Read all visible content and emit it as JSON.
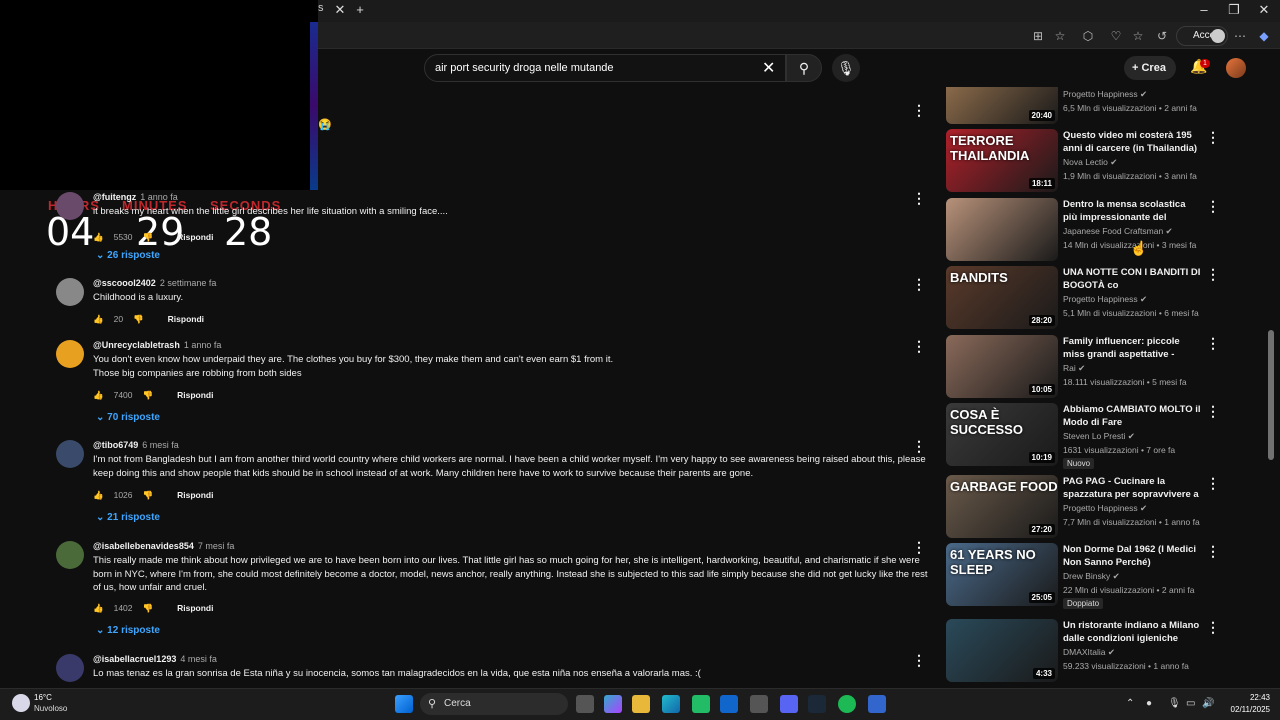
{
  "browser": {
    "tab_title": "s",
    "login_label": "Accedi"
  },
  "timer": {
    "hours_label": "HOURS",
    "minutes_label": "MINUTES",
    "seconds_label": "SECONDS",
    "hours": "04",
    "minutes": "29",
    "seconds": "28"
  },
  "youtube": {
    "search_value": "air port security droga nelle mutande",
    "create_label": "Crea",
    "notifications_count": "1"
  },
  "comments": [
    {
      "handle": "@fuitengz",
      "when": "1 anno fa",
      "text": "it breaks my heart when the little girl describes her life situation with a smiling face....",
      "likes": "5530",
      "reply_label": "Rispondi",
      "replies": "26 risposte"
    },
    {
      "handle": "@sscoool2402",
      "when": "2 settimane fa",
      "text": "Childhood is a luxury.",
      "likes": "20",
      "reply_label": "Rispondi",
      "replies": ""
    },
    {
      "handle": "@Unrecyclabletrash",
      "when": "1 anno fa",
      "text": "You don't even know how underpaid they are. The clothes you buy for $300, they make them and can't even earn $1 from it.\nThose big companies are robbing from both sides",
      "likes": "7400",
      "reply_label": "Rispondi",
      "replies": "70 risposte"
    },
    {
      "handle": "@tibo6749",
      "when": "6 mesi fa",
      "text": "I'm not from Bangladesh but I am from another third world country where child workers are normal. I have been a child worker myself. I'm very happy to see awareness being raised about this, please keep doing this and show people that kids should be in school instead of at work. Many children here have to work to survive because their parents are gone.",
      "likes": "1026",
      "reply_label": "Rispondi",
      "replies": "21 risposte"
    },
    {
      "handle": "@isabellebenavides854",
      "when": "7 mesi fa",
      "text": "This really made me think about how privileged we are to have been born into our lives. That little girl has so much going for her, she is intelligent, hardworking, beautiful, and charismatic if she were born in NYC, where I'm from, she could most definitely become a doctor, model, news anchor, really anything. Instead she is subjected to this sad life simply because she did not get lucky like the rest of us, how unfair and cruel.",
      "likes": "1402",
      "reply_label": "Rispondi",
      "replies": "12 risposte"
    },
    {
      "handle": "@isabellacruel1293",
      "when": "4 mesi fa",
      "text": "Lo mas tenaz es la gran sonrisa de Esta niña y su inocencia, somos tan malagradecidos en la vida, que esta niña nos enseña a valorarla mas. :(",
      "likes": "",
      "reply_label": "",
      "replies": ""
    }
  ],
  "videos": [
    {
      "title": "",
      "channel": "Progetto Happiness",
      "stats": "6,5 Mln di visualizzazioni • 2 anni fa",
      "duration": "20:40",
      "thumb_text": "",
      "badge": "",
      "color": "#8a6a4a"
    },
    {
      "title": "Questo video mi costerà 195 anni di carcere (in Thailandia)",
      "channel": "Nova Lectio",
      "stats": "1,9 Mln di visualizzazioni • 3 anni fa",
      "duration": "18:11",
      "thumb_text": "TERRORE THAILANDIA",
      "badge": "",
      "color": "#b0202a"
    },
    {
      "title": "Dentro la mensa scolastica più impressionante del Giappone!",
      "channel": "Japanese Food Craftsman",
      "stats": "14 Mln di visualizzazioni • 3 mesi fa",
      "duration": "",
      "thumb_text": "",
      "badge": "",
      "color": "#b8927a"
    },
    {
      "title": "UNA NOTTE CON I BANDITI DI BOGOTÀ co",
      "channel": "Progetto Happiness",
      "stats": "5,1 Mln di visualizzazioni • 6 mesi fa",
      "duration": "28:20",
      "thumb_text": "BANDITS",
      "badge": "",
      "color": "#5a3a2a"
    },
    {
      "title": "Family influencer: piccole miss grandi aspettative - FarWest ...",
      "channel": "Rai",
      "stats": "18.111 visualizzazioni • 5 mesi fa",
      "duration": "10:05",
      "thumb_text": "",
      "badge": "",
      "color": "#8a6a5a"
    },
    {
      "title": "Abbiamo CAMBIATO MOLTO il Modo di Fare COMPRAVENDIT...",
      "channel": "Steven Lo Presti",
      "stats": "1631 visualizzazioni • 7 ore fa",
      "duration": "10:19",
      "thumb_text": "COSA È SUCCESSO",
      "badge": "Nuovo",
      "color": "#3a3a3a"
    },
    {
      "title": "PAG PAG - Cucinare la spazzatura per sopravvivere a ...",
      "channel": "Progetto Happiness",
      "stats": "7,7 Mln di visualizzazioni • 1 anno fa",
      "duration": "27:20",
      "thumb_text": "GARBAGE FOOD",
      "badge": "",
      "color": "#6a5a4a"
    },
    {
      "title": "Non Dorme Dal 1962 (I Medici Non Sanno Perché)",
      "channel": "Drew Binsky",
      "stats": "22 Mln di visualizzazioni • 2 anni fa",
      "duration": "25:05",
      "thumb_text": "61 YEARS NO SLEEP",
      "badge": "Doppiato",
      "color": "#4a6a8a"
    },
    {
      "title": "Un ristorante indiano a Milano dalle condizioni igieniche molt...",
      "channel": "DMAXItalia",
      "stats": "59.233 visualizzazioni • 1 anno fa",
      "duration": "4:33",
      "thumb_text": "",
      "badge": "",
      "color": "#2a4a5a"
    }
  ],
  "taskbar": {
    "temperature": "16°C",
    "weather": "Nuvoloso",
    "search_label": "Cerca",
    "time": "22:43",
    "date": "02/11/2025"
  }
}
